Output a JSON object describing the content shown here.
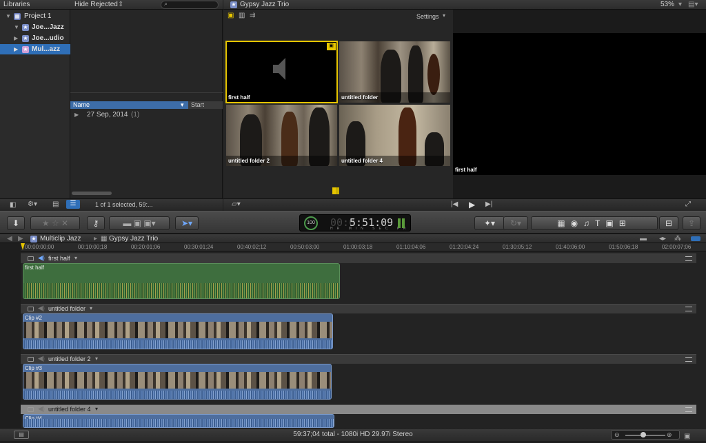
{
  "libraries": {
    "header": "Libraries",
    "filter": "Hide Rejected",
    "items": [
      {
        "label": "Project 1"
      },
      {
        "label": "Joe...Jazz"
      },
      {
        "label": "Joe...udio"
      },
      {
        "label": "Mul...azz"
      }
    ],
    "columns": {
      "name": "Name",
      "start": "Start"
    },
    "date_group": "27 Sep, 2014",
    "date_count": "(1)",
    "selection_status": "1 of 1 selected, 59:..."
  },
  "event_browser": {
    "title": "Gypsy Jazz Trio",
    "settings_label": "Settings",
    "zoom": "53%",
    "tiles": [
      {
        "label": "first half"
      },
      {
        "label": "untitled folder"
      },
      {
        "label": "untitled folder 2"
      },
      {
        "label": "untitled folder 4"
      }
    ]
  },
  "viewer": {
    "angle_label": "first half"
  },
  "toolbar": {
    "timecode": "5:51:09",
    "timecode_dim": "00:0",
    "timecode_units": "HR MIN SEC FR",
    "percent": "100"
  },
  "timeline": {
    "breadcrumb_project": "Multiclip Jazz",
    "breadcrumb_clip": "Gypsy Jazz Trio",
    "ruler_ticks": [
      "00:00:00;00",
      "00:10:00;18",
      "00:20:01;06",
      "00:30:01;24",
      "00:40:02;12",
      "00:50:03;00",
      "01:00:03;18",
      "01:10:04;06",
      "01:20:04;24",
      "01:30:05;12",
      "01:40:06;00",
      "01:50:06;18",
      "02:00:07;06"
    ],
    "lanes": [
      {
        "name": "first half",
        "clip": "first half",
        "kind": "audio"
      },
      {
        "name": "untitled folder",
        "clip": "Clip #2",
        "kind": "video"
      },
      {
        "name": "untitled folder 2",
        "clip": "Clip #3",
        "kind": "video"
      },
      {
        "name": "untitled folder 4",
        "clip": "Clip #4",
        "kind": "video"
      }
    ]
  },
  "status": {
    "text": "59:37;04 total - 1080i HD 29.97i Stereo"
  },
  "colors": {
    "selection": "#2f6fb8",
    "accent_yellow": "#e6c500",
    "audio_clip": "#3e6e3e",
    "video_clip": "#4e6e9e"
  }
}
